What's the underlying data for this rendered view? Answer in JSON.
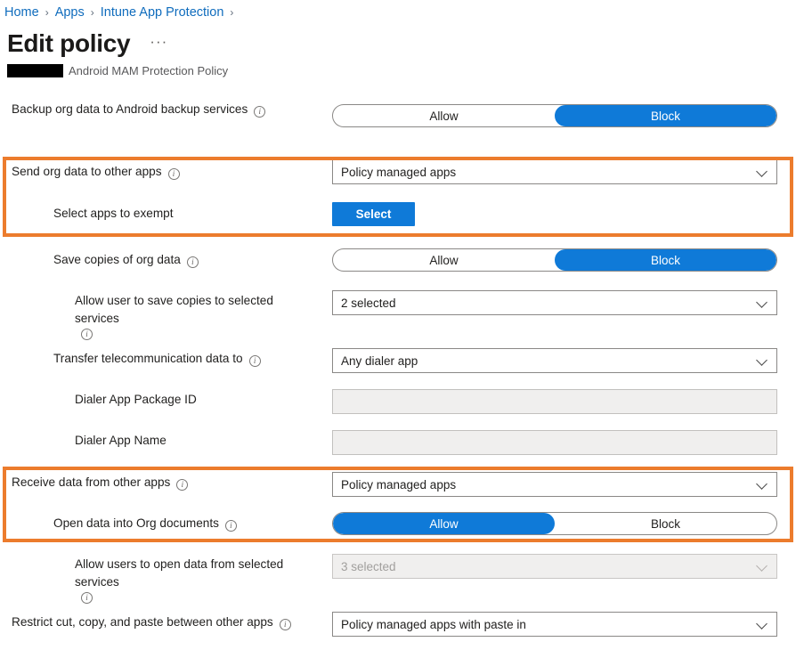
{
  "breadcrumb": {
    "items": [
      {
        "label": "Home"
      },
      {
        "label": "Apps"
      },
      {
        "label": "Intune App Protection"
      }
    ],
    "separator": "›"
  },
  "header": {
    "title": "Edit policy",
    "more_actions": "···",
    "subtitle": "Android MAM Protection Policy",
    "redacted_label": ""
  },
  "icons": {
    "info": "i"
  },
  "colors": {
    "accent_blue": "#0f7ad8",
    "link_blue": "#0f6cbd",
    "highlight_orange": "#ec7c2d",
    "disabled_bg": "#f0efee",
    "border_gray": "#8a8886"
  },
  "rows": [
    {
      "id": "backup-org-data",
      "label": "Backup org data to Android backup services",
      "has_info": true,
      "indent": 1,
      "control": "toggle",
      "options": [
        "Allow",
        "Block"
      ],
      "selected": "Block",
      "disabled": false
    },
    {
      "id": "send-org-data-to-other-apps",
      "label": "Send org data to other apps",
      "has_info": true,
      "indent": 1,
      "control": "dropdown",
      "value": "Policy managed apps",
      "disabled": false
    },
    {
      "id": "select-apps-to-exempt",
      "label": "Select apps to exempt",
      "has_info": false,
      "indent": 2,
      "control": "button",
      "value": "Select",
      "disabled": false
    },
    {
      "id": "save-copies-of-org-data",
      "label": "Save copies of org data",
      "has_info": true,
      "indent": 2,
      "control": "toggle",
      "options": [
        "Allow",
        "Block"
      ],
      "selected": "Block",
      "disabled": false
    },
    {
      "id": "allow-user-save-copies-selected-services",
      "label": "Allow user to save copies to selected services",
      "has_info": true,
      "indent": 3,
      "control": "dropdown",
      "value": "2 selected",
      "disabled": false
    },
    {
      "id": "transfer-telecommunication-data-to",
      "label": "Transfer telecommunication data to",
      "has_info": true,
      "indent": 2,
      "control": "dropdown",
      "value": "Any dialer app",
      "disabled": false
    },
    {
      "id": "dialer-app-package-id",
      "label": "Dialer App Package ID",
      "has_info": false,
      "indent": 3,
      "control": "textinput",
      "value": "",
      "placeholder": "",
      "disabled": true
    },
    {
      "id": "dialer-app-name",
      "label": "Dialer App Name",
      "has_info": false,
      "indent": 3,
      "control": "textinput",
      "value": "",
      "placeholder": "",
      "disabled": true
    },
    {
      "id": "receive-data-from-other-apps",
      "label": "Receive data from other apps",
      "has_info": true,
      "indent": 1,
      "control": "dropdown",
      "value": "Policy managed apps",
      "disabled": false
    },
    {
      "id": "open-data-into-org-documents",
      "label": "Open data into Org documents",
      "has_info": true,
      "indent": 2,
      "control": "toggle",
      "options": [
        "Allow",
        "Block"
      ],
      "selected": "Allow",
      "disabled": false
    },
    {
      "id": "allow-users-open-data-selected-services",
      "label": "Allow users to open data from selected services",
      "has_info": true,
      "indent": 3,
      "control": "dropdown",
      "value": "3 selected",
      "disabled": true
    },
    {
      "id": "restrict-cut-copy-paste",
      "label": "Restrict cut, copy, and paste between other apps",
      "has_info": true,
      "indent": 1,
      "control": "dropdown",
      "value": "Policy managed apps with paste in",
      "disabled": false
    }
  ],
  "callouts": [
    {
      "id": "callout-send-org-data",
      "covers": [
        "send-org-data-to-other-apps",
        "select-apps-to-exempt"
      ]
    },
    {
      "id": "callout-receive-data",
      "covers": [
        "receive-data-from-other-apps",
        "open-data-into-org-documents"
      ]
    }
  ]
}
